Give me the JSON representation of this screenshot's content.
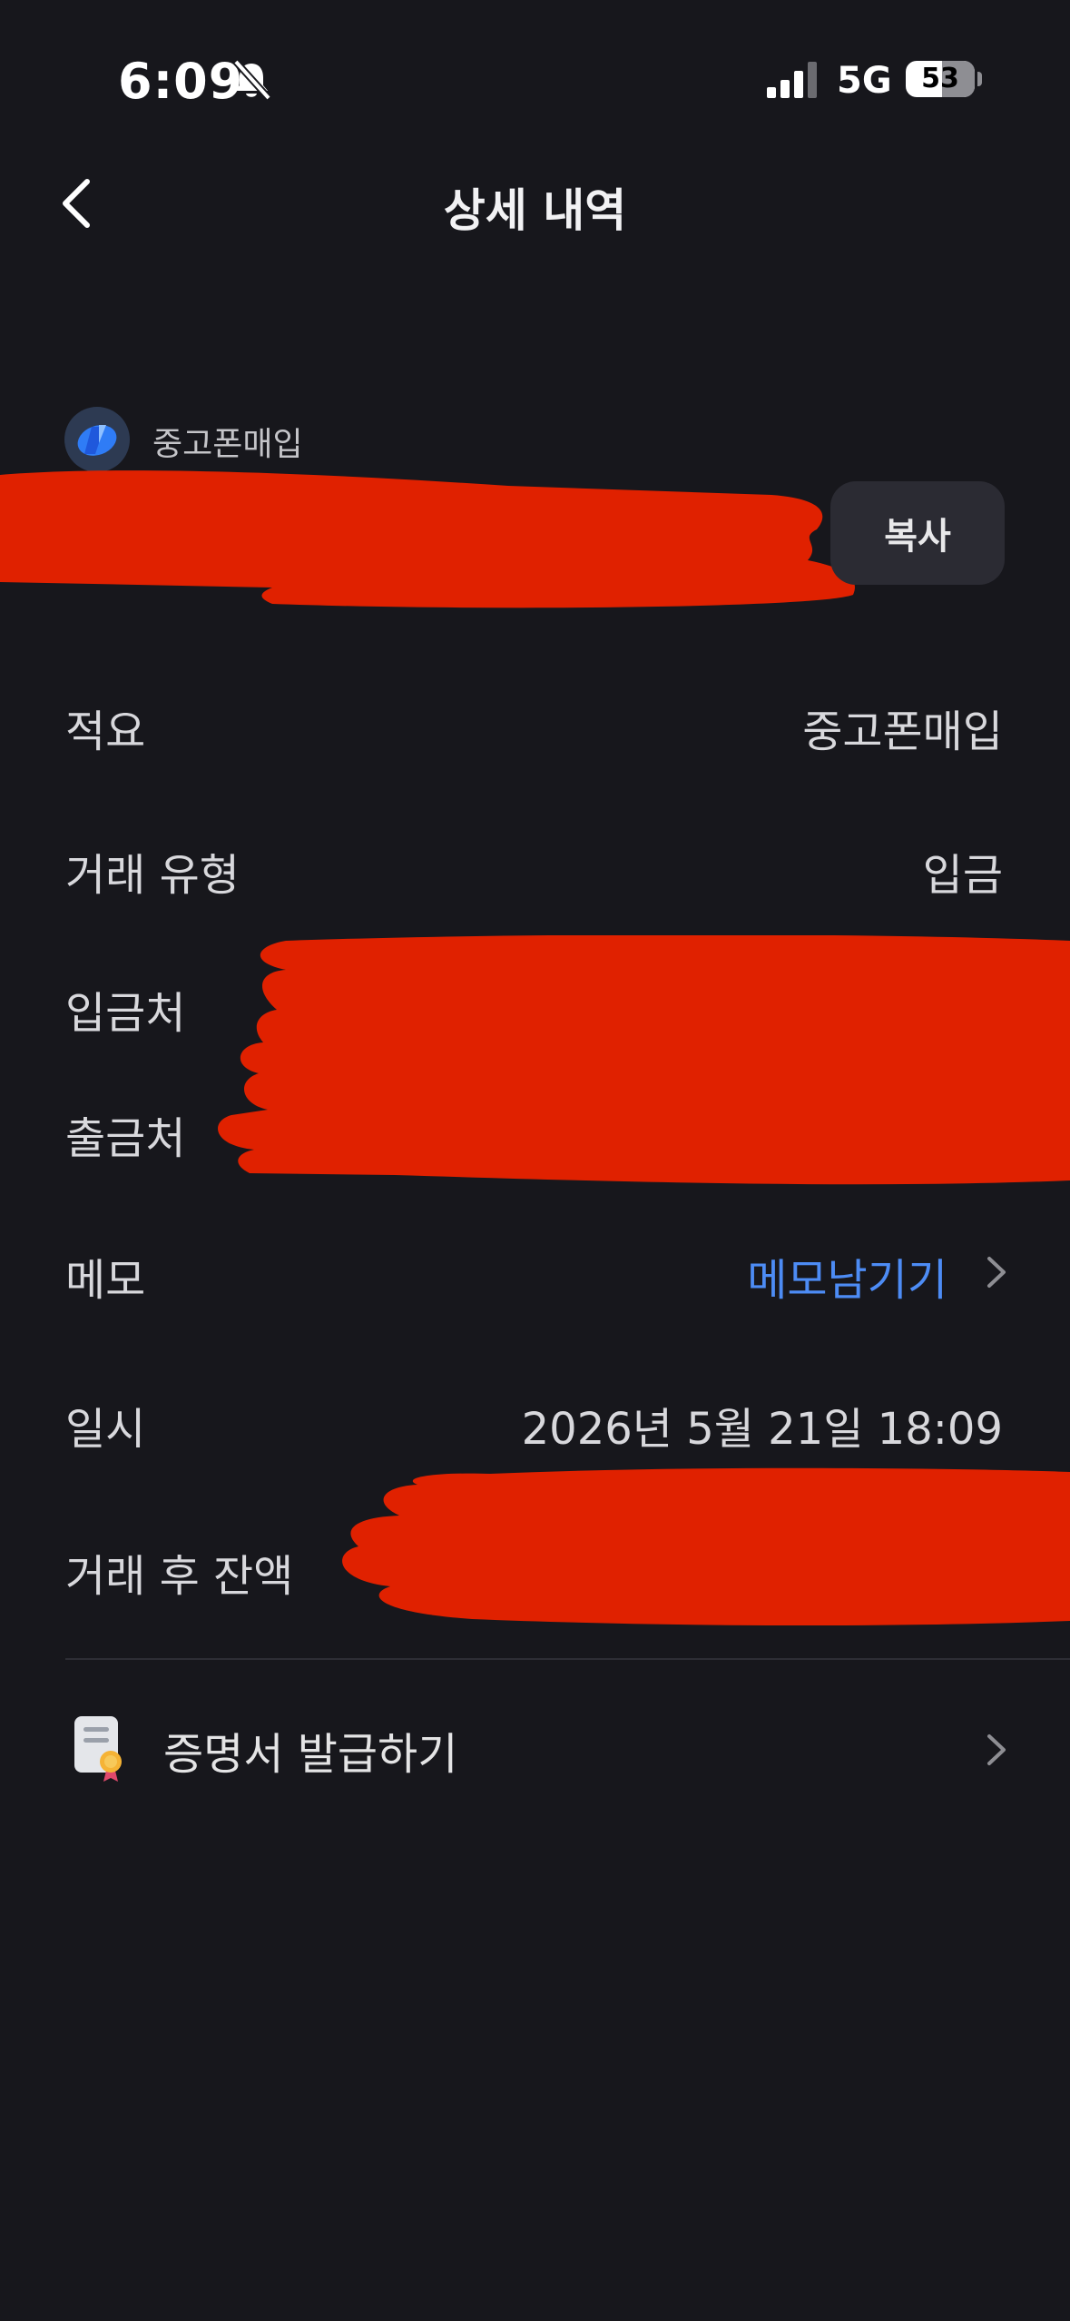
{
  "status_bar": {
    "time": "6:09",
    "network": "5G",
    "battery_level": "53",
    "silent_icon": "bell-slash-icon",
    "signal_icon": "cellular-signal-icon"
  },
  "header": {
    "title": "상세 내역",
    "back_icon": "chevron-left-icon"
  },
  "transaction": {
    "merchant_name": "중고폰매입",
    "copy_label": "복사"
  },
  "details": {
    "description_label": "적요",
    "description_value": "중고폰매입",
    "type_label": "거래 유형",
    "type_value": "입금",
    "deposit_from_label": "입금처",
    "withdraw_from_label": "출금처",
    "memo_label": "메모",
    "memo_link": "메모남기기",
    "datetime_label": "일시",
    "datetime_value": "2026년 5월 21일 18:09",
    "balance_after_label": "거래 후 잔액"
  },
  "certificate": {
    "label": "증명서 발급하기",
    "icon": "certificate-icon"
  },
  "colors": {
    "background": "#17171c",
    "accent_link": "#4d8cf5",
    "redaction": "#e02100",
    "button_bg": "#2b2b33"
  }
}
